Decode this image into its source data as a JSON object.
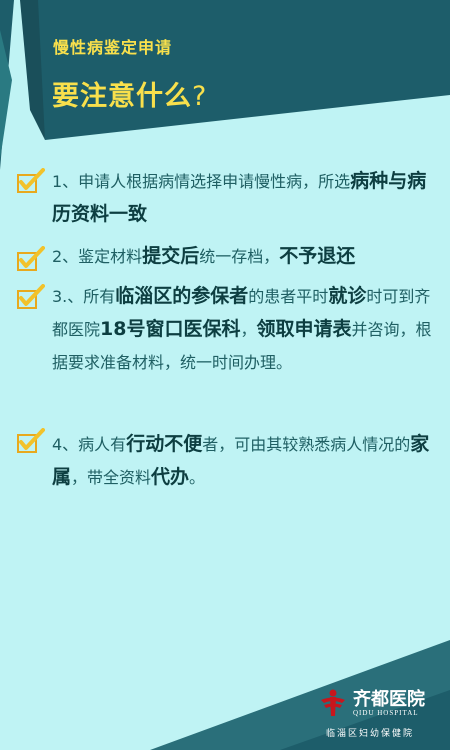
{
  "header": {
    "subtitle": "慢性病鉴定申请",
    "title": "要注意什么",
    "title_mark": "?"
  },
  "items": [
    {
      "parts": [
        {
          "text": "1、申请人根据病情选择申请慢性病，所选",
          "bold": false
        },
        {
          "text": "病种与病历资料一致",
          "bold": true
        }
      ]
    },
    {
      "parts": [
        {
          "text": "2、鉴定材料",
          "bold": false
        },
        {
          "text": "提交后",
          "bold": true
        },
        {
          "text": "统一存档，",
          "bold": false
        },
        {
          "text": "不予退还",
          "bold": true
        }
      ]
    },
    {
      "parts": [
        {
          "text": "3.、所有",
          "bold": false
        },
        {
          "text": "临淄区的参保者",
          "bold": true
        },
        {
          "text": "的患者平时",
          "bold": false
        },
        {
          "text": "就诊",
          "bold": true
        },
        {
          "text": "时可到齐都医院",
          "bold": false
        },
        {
          "text": "18号窗口医保科",
          "bold": true
        },
        {
          "text": "，",
          "bold": false
        },
        {
          "text": "领取申请表",
          "bold": true
        },
        {
          "text": "并咨询，根据要求准备材料，统一时间办理。",
          "bold": false
        }
      ]
    },
    {
      "parts": [
        {
          "text": "4、病人有",
          "bold": false
        },
        {
          "text": "行动不便",
          "bold": true
        },
        {
          "text": "者，可由其较熟悉病人情况的",
          "bold": false
        },
        {
          "text": "家属",
          "bold": true
        },
        {
          "text": "，带全资料",
          "bold": false
        },
        {
          "text": "代办",
          "bold": true
        },
        {
          "text": "。",
          "bold": false
        }
      ]
    }
  ],
  "footer": {
    "logo_name": "齐都医院",
    "logo_en": "QIDU HOSPITAL",
    "logo_sub": "临淄区妇幼保健院"
  },
  "colors": {
    "background": "#bff3f4",
    "header_dark": "#1d5d6a",
    "accent_yellow": "#f9e04c",
    "body_text": "#1f5f63",
    "logo_red": "#c8161d"
  }
}
